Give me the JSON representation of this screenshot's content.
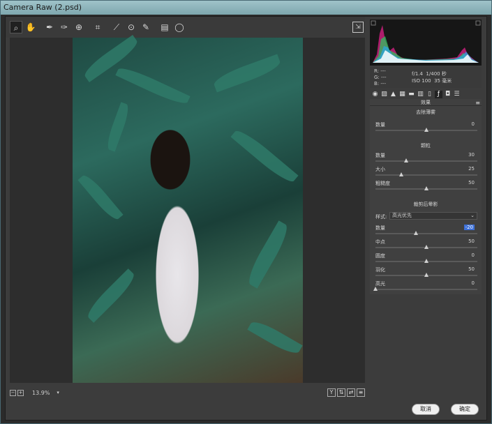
{
  "window": {
    "title": "Camera Raw (2.psd)"
  },
  "toolbar": {
    "tools": [
      "zoom-tool",
      "hand-tool",
      "white-balance-tool",
      "color-sampler-tool",
      "targeted-adjustment-tool",
      "crop-tool",
      "straighten-tool",
      "spot-removal-tool",
      "red-eye-tool",
      "adjustment-brush",
      "graduated-filter",
      "radial-filter"
    ]
  },
  "zoom": {
    "minus": "−",
    "plus": "+",
    "value": "13.9%"
  },
  "view_buttons": {
    "y": "Y",
    "b": "⇅",
    "c": "⇄",
    "d": "≡"
  },
  "info": {
    "r": "R:  ---",
    "g": "G:  ---",
    "b": "B:  ---",
    "aperture": "f/1.4",
    "shutter": "1/400 秒",
    "iso": "ISO 100",
    "focal": "35 毫米"
  },
  "panel": {
    "title": "效果",
    "dehaze": {
      "title": "去除薄雾",
      "amount_label": "数量",
      "amount": "0",
      "knob": 0.5
    },
    "grain": {
      "title": "颗粒",
      "amount_label": "数量",
      "amount": "30",
      "amount_knob": 0.3,
      "size_label": "大小",
      "size": "25",
      "size_knob": 0.25,
      "rough_label": "粗糙度",
      "rough": "50",
      "rough_knob": 0.5
    },
    "vignette": {
      "title": "裁剪后晕影",
      "style_label": "样式:",
      "style_value": "高光优先",
      "amount_label": "数量",
      "amount": "-20",
      "amount_knob": 0.4,
      "mid_label": "中点",
      "mid": "50",
      "mid_knob": 0.5,
      "round_label": "圆度",
      "round": "0",
      "round_knob": 0.5,
      "feather_label": "羽化",
      "feather": "50",
      "feather_knob": 0.5,
      "high_label": "高光",
      "high": "0",
      "high_knob": 0.0
    }
  },
  "footer": {
    "cancel": "取消",
    "ok": "确定"
  }
}
